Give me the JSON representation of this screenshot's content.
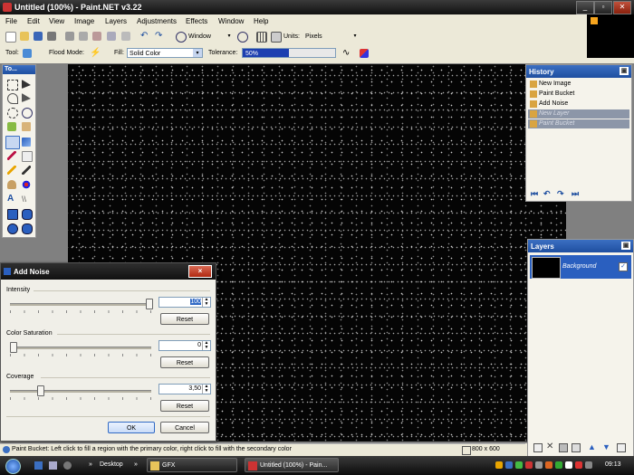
{
  "window": {
    "title": "Untitled (100%) - Paint.NET v3.22"
  },
  "menu": [
    "File",
    "Edit",
    "View",
    "Image",
    "Layers",
    "Adjustments",
    "Effects",
    "Window",
    "Help"
  ],
  "toolbar": {
    "zoom_value": "Window",
    "units_label": "Units:",
    "units_value": "Pixels"
  },
  "tool_options": {
    "tool_label": "Tool:",
    "flood_mode_label": "Flood Mode:",
    "fill_label": "Fill:",
    "fill_value": "Solid Color",
    "tolerance_label": "Tolerance:",
    "tolerance_value": "50%",
    "tolerance_fraction": 0.5
  },
  "tools_panel": {
    "title": "To..."
  },
  "history": {
    "title": "History",
    "items": [
      {
        "label": "New Image",
        "undone": false
      },
      {
        "label": "Paint Bucket",
        "undone": false
      },
      {
        "label": "Add Noise",
        "undone": false
      },
      {
        "label": "New Layer",
        "undone": true
      },
      {
        "label": "Paint Bucket",
        "undone": true
      }
    ]
  },
  "layers": {
    "title": "Layers",
    "items": [
      {
        "name": "Background",
        "visible": true
      }
    ]
  },
  "dialog": {
    "title": "Add Noise",
    "close": "×",
    "intensity": {
      "label": "Intensity",
      "value": "100",
      "reset": "Reset",
      "fraction": 1.0
    },
    "saturation": {
      "label": "Color Saturation",
      "value": "0",
      "reset": "Reset",
      "fraction": 0.0
    },
    "coverage": {
      "label": "Coverage",
      "value": "3,50",
      "reset": "Reset",
      "fraction": 0.2
    },
    "ok": "OK",
    "cancel": "Cancel"
  },
  "status": {
    "hint": "Paint Bucket: Left click to fill a region with the primary color, right click to fill with the secondary color",
    "size": "800 x 600"
  },
  "taskbar": {
    "desktop": "Desktop",
    "gfx": "GFX",
    "paintnet": "Untitled (100%) - Pain...",
    "clock": "09:13",
    "arrows": "»"
  },
  "colors": {
    "primary": "#2a5fbf",
    "accent": "#f7a51e"
  }
}
